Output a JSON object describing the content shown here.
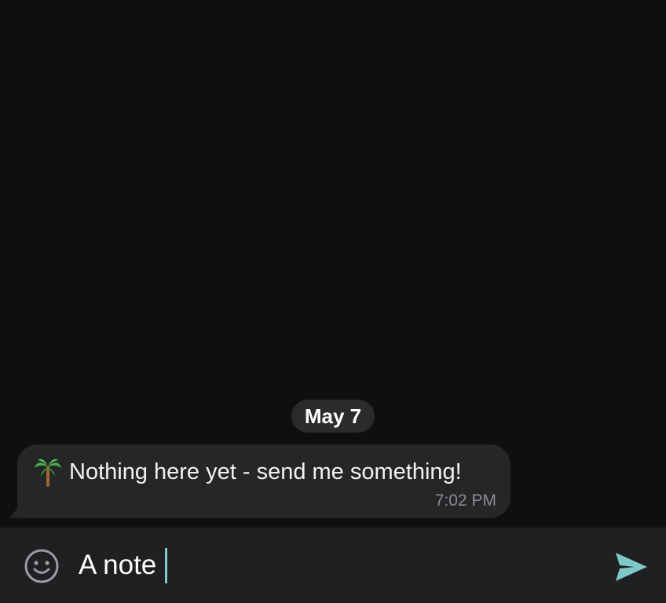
{
  "chat": {
    "date_separator": "May 7",
    "messages": [
      {
        "emoji": "palm-tree",
        "text": "Nothing here yet - send me something!",
        "time": "7:02 PM"
      }
    ]
  },
  "composer": {
    "value": "A note",
    "emoji_icon": "smiley-icon",
    "send_icon": "send-icon"
  },
  "colors": {
    "background": "#0f0f10",
    "bubble": "#252628",
    "input_bar": "#1f2022",
    "accent": "#7fc8c8"
  }
}
